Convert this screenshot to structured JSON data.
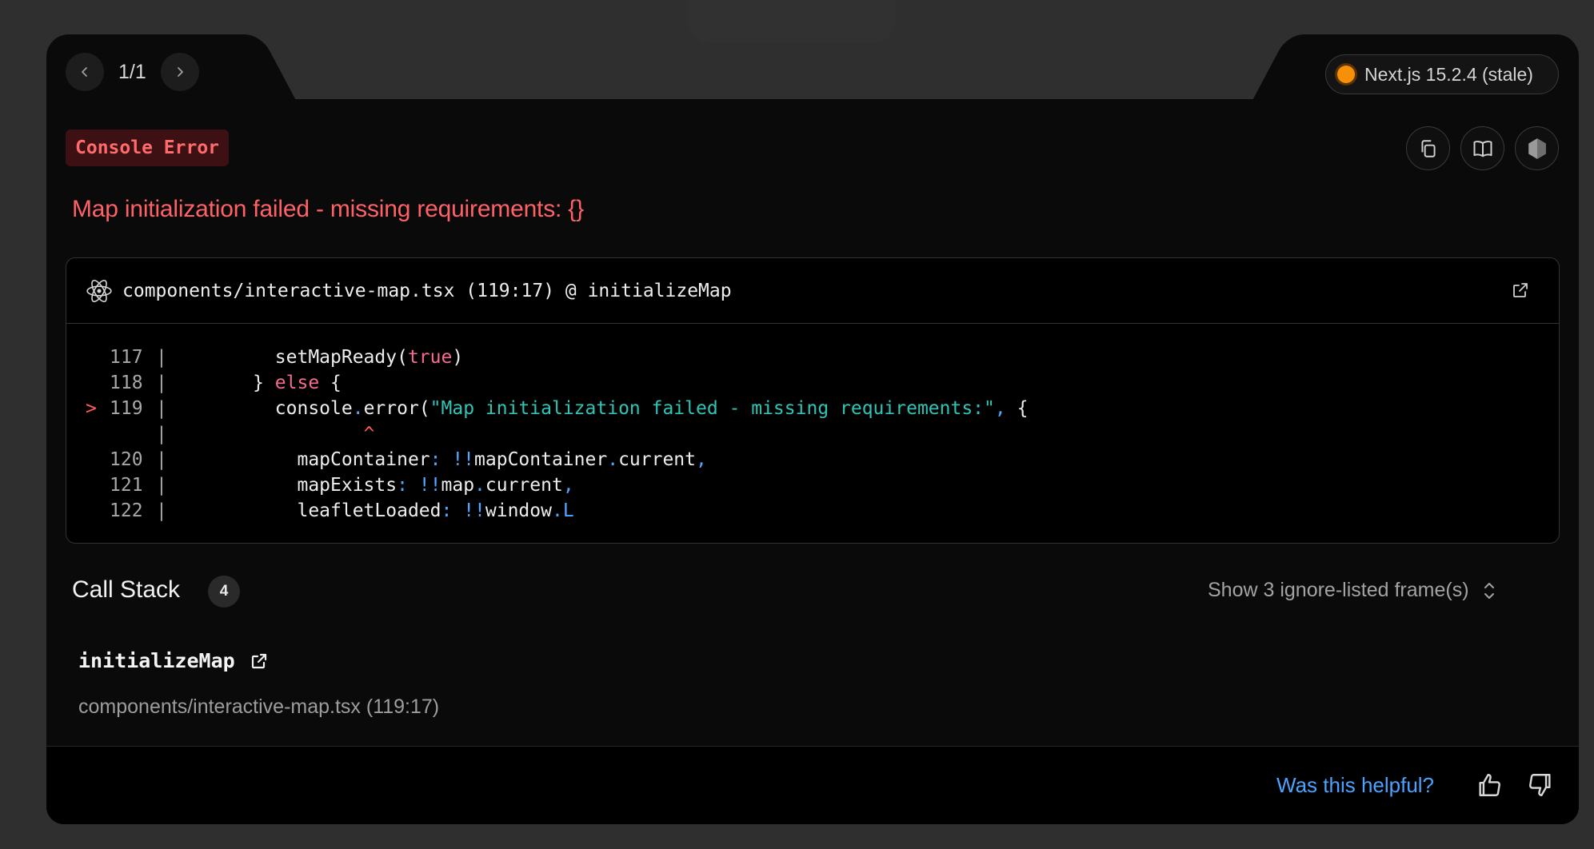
{
  "nav": {
    "prev_icon": "chevron-left-icon",
    "counter": "1/1",
    "next_icon": "chevron-right-icon"
  },
  "version": {
    "label": "Next.js 15.2.4 (stale)",
    "status_color": "#f79009"
  },
  "error": {
    "badge": "Console Error",
    "title": "Map initialization failed - missing requirements: {}"
  },
  "tools": {
    "copy_icon": "copy-icon",
    "docs_icon": "book-icon",
    "node_icon": "nodejs-icon"
  },
  "code_frame": {
    "file_ref": "components/interactive-map.tsx (119:17) @ initializeMap",
    "lines": [
      {
        "num": "117",
        "marker": "",
        "parts": [
          {
            "t": "        setMapReady(",
            "c": ""
          },
          {
            "t": "true",
            "c": "kw"
          },
          {
            "t": ")",
            "c": ""
          }
        ]
      },
      {
        "num": "118",
        "marker": "",
        "parts": [
          {
            "t": "      } ",
            "c": ""
          },
          {
            "t": "else",
            "c": "kw"
          },
          {
            "t": " {",
            "c": ""
          }
        ]
      },
      {
        "num": "119",
        "marker": ">",
        "parts": [
          {
            "t": "        console",
            "c": ""
          },
          {
            "t": ".",
            "c": "pun"
          },
          {
            "t": "error(",
            "c": ""
          },
          {
            "t": "\"Map initialization failed - missing requirements:\"",
            "c": "str"
          },
          {
            "t": ",",
            "c": "pun"
          },
          {
            "t": " {",
            "c": ""
          }
        ]
      },
      {
        "num": "",
        "marker": "",
        "parts": [
          {
            "t": "                ^",
            "c": "caret"
          }
        ]
      },
      {
        "num": "120",
        "marker": "",
        "parts": [
          {
            "t": "          mapContainer",
            "c": ""
          },
          {
            "t": ": !!",
            "c": "pun"
          },
          {
            "t": "mapContainer",
            "c": ""
          },
          {
            "t": ".",
            "c": "pun"
          },
          {
            "t": "current",
            "c": ""
          },
          {
            "t": ",",
            "c": "pun"
          }
        ]
      },
      {
        "num": "121",
        "marker": "",
        "parts": [
          {
            "t": "          mapExists",
            "c": ""
          },
          {
            "t": ": !!",
            "c": "pun"
          },
          {
            "t": "map",
            "c": ""
          },
          {
            "t": ".",
            "c": "pun"
          },
          {
            "t": "current",
            "c": ""
          },
          {
            "t": ",",
            "c": "pun"
          }
        ]
      },
      {
        "num": "122",
        "marker": "",
        "parts": [
          {
            "t": "          leafletLoaded",
            "c": ""
          },
          {
            "t": ": !!",
            "c": "pun"
          },
          {
            "t": "window",
            "c": ""
          },
          {
            "t": ".L",
            "c": "pun"
          }
        ]
      }
    ]
  },
  "call_stack": {
    "title": "Call Stack",
    "count": "4",
    "ignore_toggle": "Show 3 ignore-listed frame(s)",
    "frames": [
      {
        "fn": "initializeMap",
        "file": "components/interactive-map.tsx (119:17)"
      }
    ]
  },
  "footer": {
    "helpful": "Was this helpful?",
    "up_icon": "thumbs-up-icon",
    "down_icon": "thumbs-down-icon"
  }
}
